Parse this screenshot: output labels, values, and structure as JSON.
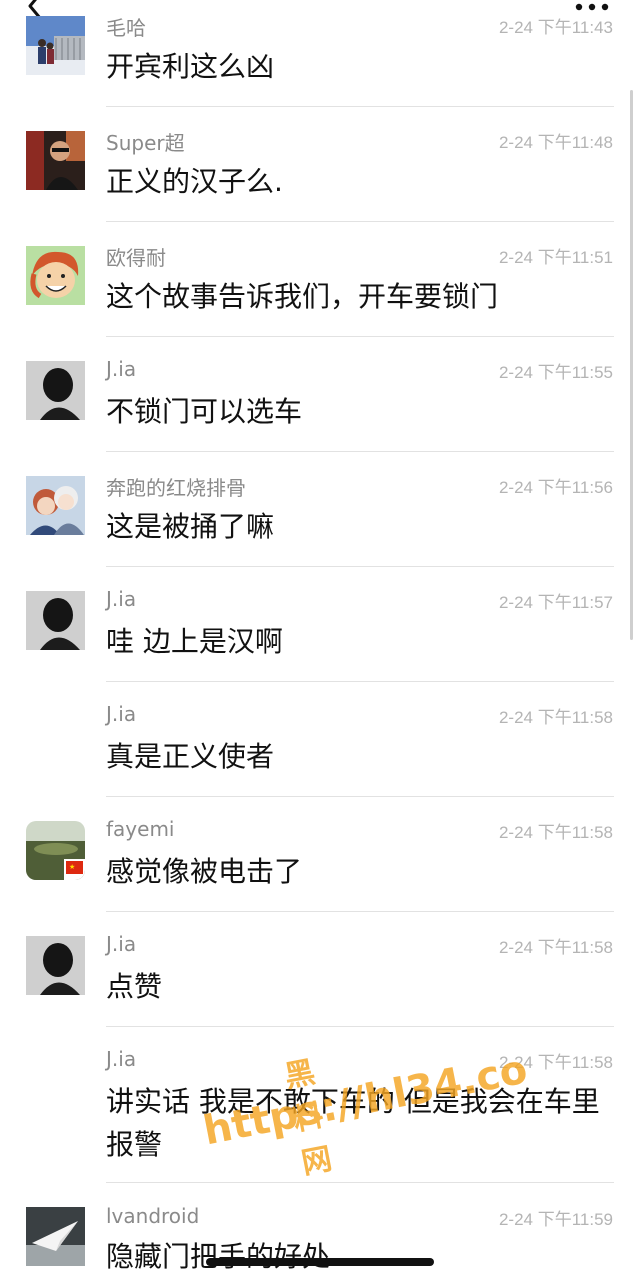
{
  "comments": [
    {
      "name": "毛哈",
      "time": "2-24 下午11:43",
      "text": "开宾利这么凶",
      "avatar": "photo-snow-couple"
    },
    {
      "name": "Super超",
      "time": "2-24 下午11:48",
      "text": "正义的汉子么.",
      "avatar": "photo-man-glasses"
    },
    {
      "name": "欧得耐",
      "time": "2-24 下午11:51",
      "text": "这个故事告诉我们，开车要锁门",
      "avatar": "cartoon-redhair"
    },
    {
      "name": "J.ia",
      "time": "2-24 下午11:55",
      "text": "不锁门可以选车",
      "avatar": "photo-dark-hair"
    },
    {
      "name": "奔跑的红烧排骨",
      "time": "2-24 下午11:56",
      "text": "这是被捅了嘛",
      "avatar": "anime-characters"
    },
    {
      "name": "J.ia",
      "time": "2-24 下午11:57",
      "text": "哇 边上是汉啊",
      "avatar": "photo-dark-hair"
    },
    {
      "name": "J.ia",
      "time": "2-24 下午11:58",
      "text": "真是正义使者",
      "avatar": ""
    },
    {
      "name": "fayemi",
      "time": "2-24 下午11:58",
      "text": "感觉像被电击了",
      "avatar": "photo-landscape-flag"
    },
    {
      "name": "J.ia",
      "time": "2-24 下午11:58",
      "text": "点赞",
      "avatar": "photo-dark-hair"
    },
    {
      "name": "J.ia",
      "time": "2-24 下午11:58",
      "text": "讲实话 我是不敢下车的 但是我会在车里报警",
      "avatar": ""
    },
    {
      "name": "lvandroid",
      "time": "2-24 下午11:59",
      "text": "隐藏门把手的好处",
      "avatar": "paper-plane"
    }
  ],
  "watermark": {
    "chinese": "黑料网",
    "url": "https://hl34.co"
  },
  "icons": {
    "back": "chevron-left-icon",
    "more": "more-dots-icon"
  },
  "colors": {
    "text": "#111111",
    "meta": "#8a8a8a",
    "time": "#b4b4b4",
    "watermark": "#f5a623"
  }
}
